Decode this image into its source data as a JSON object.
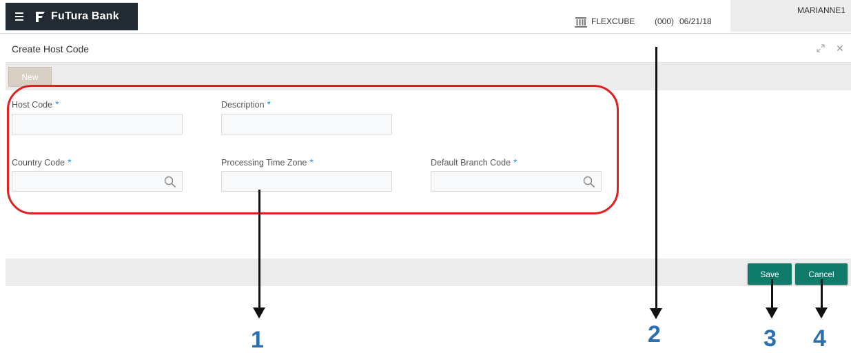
{
  "header": {
    "brand_name": "FuTura Bank",
    "product": "FLEXCUBE",
    "branch": "(000)",
    "date": "06/21/18",
    "user": "MARIANNE1"
  },
  "window": {
    "title": "Create Host Code"
  },
  "toolbar": {
    "new_label": "New"
  },
  "form": {
    "required_marker": "*",
    "fields": [
      {
        "label": "Host Code",
        "value": "",
        "required": true
      },
      {
        "label": "Description",
        "value": "",
        "required": true
      },
      {
        "label": "Country Code",
        "value": "",
        "required": true,
        "lookup": true
      },
      {
        "label": "Processing Time Zone",
        "value": "",
        "required": true
      },
      {
        "label": "Default Branch Code",
        "value": "",
        "required": true,
        "lookup": true
      }
    ]
  },
  "footer": {
    "save_label": "Save",
    "cancel_label": "Cancel"
  },
  "callouts": [
    "1",
    "2",
    "3",
    "4"
  ],
  "colors": {
    "brand_bg": "#222a33",
    "primary_button": "#0f7b6b",
    "required_marker": "#2a8fd1",
    "highlight": "#e02020",
    "callout_number": "#2b6fb0"
  },
  "icons": [
    "hamburger-icon",
    "futura-logo-icon",
    "bank-icon",
    "minimize-icon",
    "close-icon",
    "search-icon"
  ]
}
